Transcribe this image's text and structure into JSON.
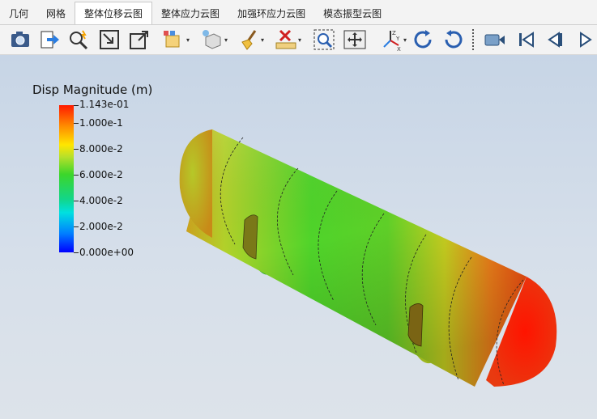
{
  "tabs": [
    {
      "label": "几何",
      "active": false
    },
    {
      "label": "网格",
      "active": false
    },
    {
      "label": "整体位移云图",
      "active": true
    },
    {
      "label": "整体应力云图",
      "active": false
    },
    {
      "label": "加强环应力云图",
      "active": false
    },
    {
      "label": "模态振型云图",
      "active": false
    }
  ],
  "toolbar_icons": [
    "camera-icon",
    "export-icon",
    "pick-icon",
    "zoom-box-icon",
    "zoom-extent-icon",
    "box-view-icon",
    "cube-view-icon",
    "light-icon",
    "clear-icon",
    "ruler-icon",
    "zoom-fit-icon",
    "pan-icon",
    "axes-icon",
    "rotate-cw-icon",
    "rotate-ccw-icon",
    "record-icon",
    "first-frame-icon",
    "prev-frame-icon",
    "play-icon"
  ],
  "legend": {
    "title": "Disp Magnitude (m)",
    "labels": [
      "1.143e-01",
      "1.000e-1",
      "8.000e-2",
      "6.000e-2",
      "4.000e-2",
      "2.000e-2",
      "0.000e+00"
    ],
    "colors": {
      "max": "#ff1a00",
      "mid": "#3cd62a",
      "min": "#0000ff"
    }
  }
}
